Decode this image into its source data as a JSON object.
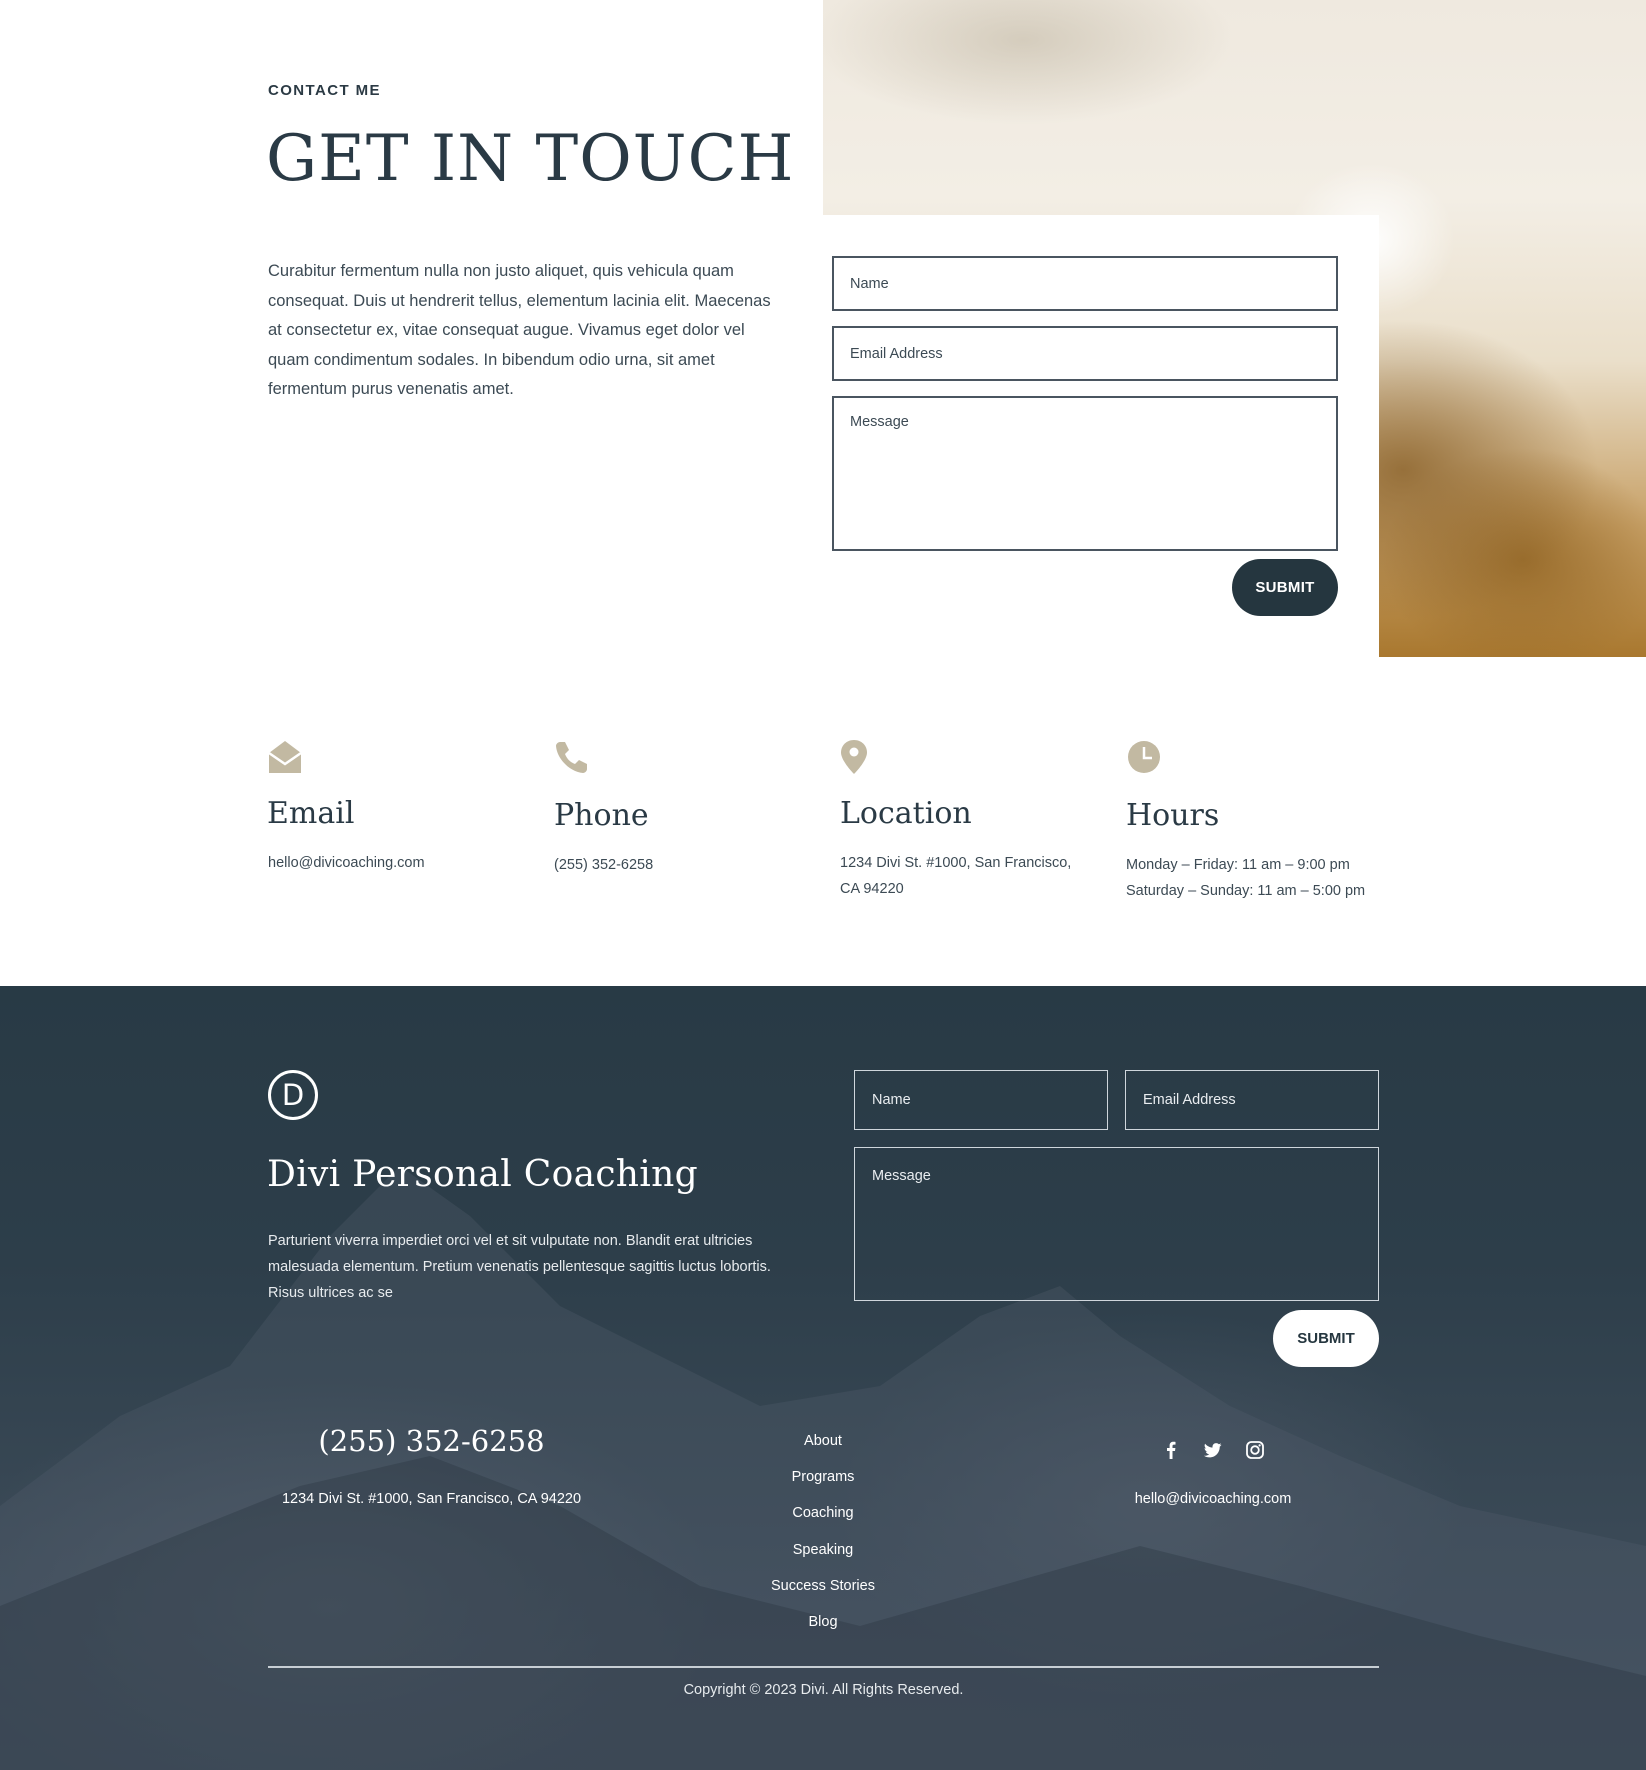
{
  "contact": {
    "eyebrow": "CONTACT ME",
    "title": "GET IN TOUCH",
    "intro": "Curabitur fermentum nulla non justo aliquet, quis vehicula quam consequat. Duis ut hendrerit tellus, elementum lacinia elit. Maecenas at consectetur ex, vitae consequat augue. Vivamus eget dolor vel quam condimentum sodales. In bibendum odio urna, sit amet fermentum purus venenatis amet.",
    "form": {
      "name_placeholder": "Name",
      "email_placeholder": "Email Address",
      "message_placeholder": "Message",
      "submit_label": "SUBMIT"
    }
  },
  "info": {
    "icon_color": "#c2b9a2",
    "items": [
      {
        "icon": "envelope-open-icon",
        "title": "Email",
        "text": "hello@divicoaching.com"
      },
      {
        "icon": "phone-icon",
        "title": "Phone",
        "text": "(255) 352-6258"
      },
      {
        "icon": "map-pin-icon",
        "title": "Location",
        "text_line1": "1234 Divi St. #1000, San Francisco,",
        "text_line2": "CA 94220"
      },
      {
        "icon": "clock-icon",
        "title": "Hours",
        "text_line1": "Monday – Friday: 11 am – 9:00 pm",
        "text_line2": "Saturday – Sunday: 11 am – 5:00 pm"
      }
    ]
  },
  "footer": {
    "logo_letter": "D",
    "title": "Divi Personal Coaching",
    "description": "Parturient viverra imperdiet orci vel et sit vulputate non. Blandit erat ultricies malesuada elementum. Pretium venenatis pellentesque sagittis luctus lobortis. Risus ultrices ac se",
    "form": {
      "name_placeholder": "Name",
      "email_placeholder": "Email Address",
      "message_placeholder": "Message",
      "submit_label": "SUBMIT"
    },
    "phone": "(255) 352-6258",
    "address": "1234 Divi St. #1000, San Francisco, CA 94220",
    "nav": [
      "About",
      "Programs",
      "Coaching",
      "Speaking",
      "Success Stories",
      "Blog"
    ],
    "social": [
      "facebook-icon",
      "twitter-icon",
      "instagram-icon"
    ],
    "email": "hello@divicoaching.com",
    "copyright": "Copyright © 2023 Divi. All Rights Reserved."
  },
  "colors": {
    "primary_dark": "#25363f",
    "text": "#2a3a45",
    "accent_icon": "#c2b9a2"
  }
}
